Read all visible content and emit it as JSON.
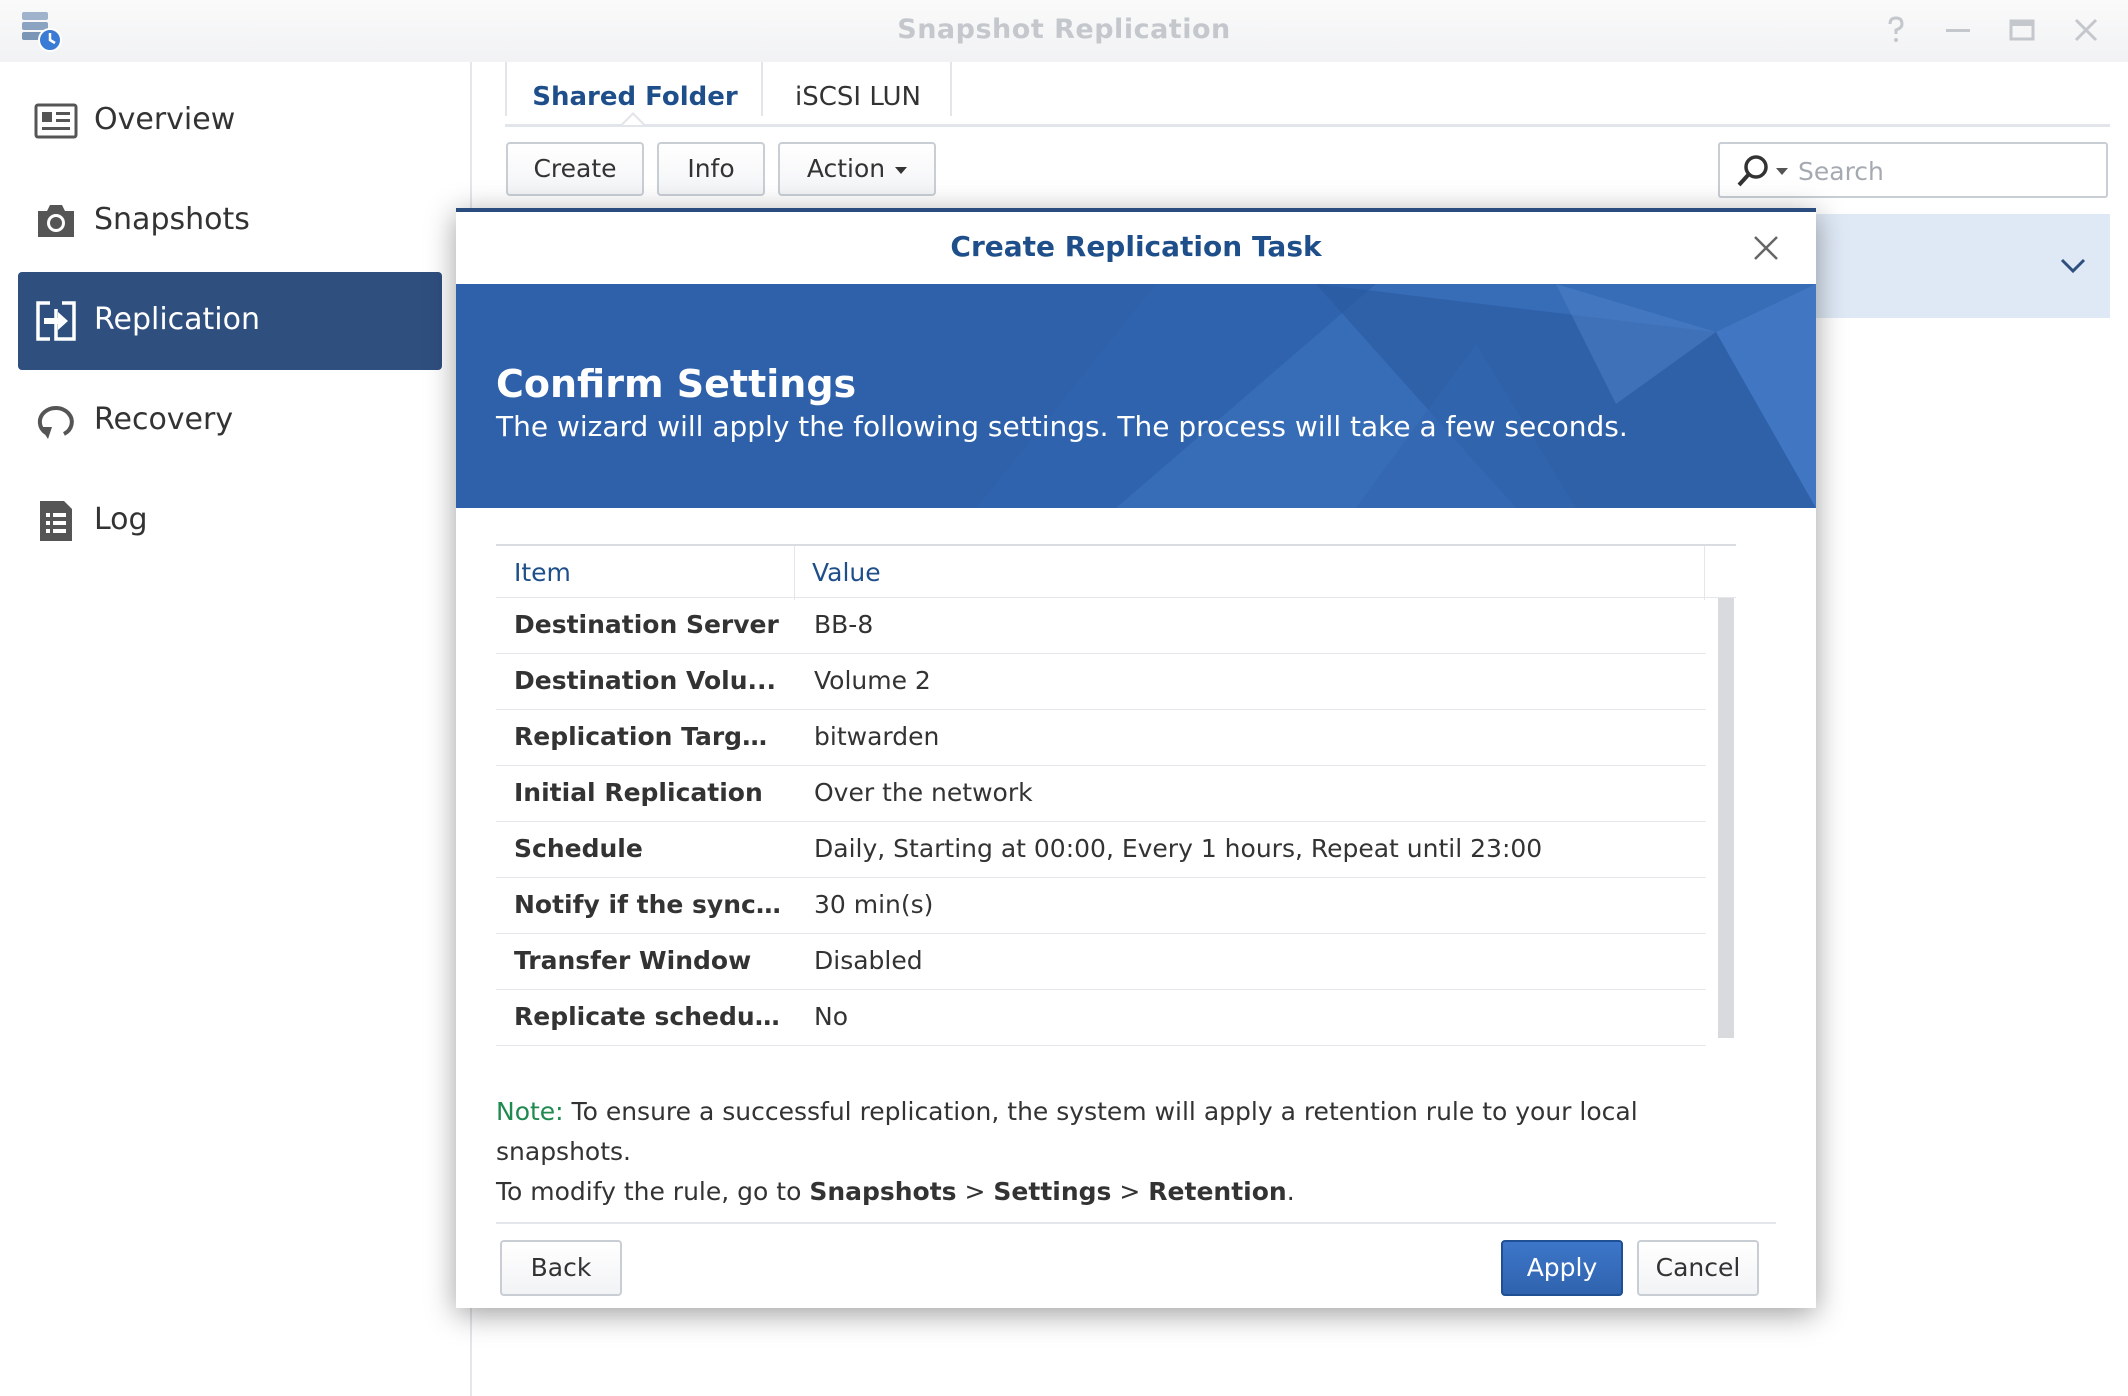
{
  "window": {
    "title": "Snapshot Replication",
    "controls": [
      "help-icon",
      "minimize-icon",
      "maximize-icon",
      "close-icon"
    ]
  },
  "sidebar": {
    "items": [
      {
        "label": "Overview",
        "icon": "overview-icon",
        "active": false
      },
      {
        "label": "Snapshots",
        "icon": "camera-icon",
        "active": false
      },
      {
        "label": "Replication",
        "icon": "replication-icon",
        "active": true
      },
      {
        "label": "Recovery",
        "icon": "recovery-icon",
        "active": false
      },
      {
        "label": "Log",
        "icon": "log-icon",
        "active": false
      }
    ]
  },
  "tabs": [
    {
      "label": "Shared Folder",
      "active": true
    },
    {
      "label": "iSCSI LUN",
      "active": false
    }
  ],
  "toolbar": {
    "create_label": "Create",
    "info_label": "Info",
    "action_label": "Action"
  },
  "search": {
    "placeholder": "Search",
    "value": ""
  },
  "dialog": {
    "title": "Create Replication Task",
    "banner_title": "Confirm Settings",
    "banner_subtitle": "The wizard will apply the following settings. The process will take a few seconds.",
    "table": {
      "headers": [
        "Item",
        "Value"
      ],
      "rows": [
        {
          "item": "Destination Server",
          "value": "BB-8"
        },
        {
          "item": "Destination Volu...",
          "value": "Volume 2"
        },
        {
          "item": "Replication Targe...",
          "value": "bitwarden"
        },
        {
          "item": "Initial Replication",
          "value": "Over the network"
        },
        {
          "item": "Schedule",
          "value": "Daily, Starting at 00:00, Every 1 hours, Repeat until 23:00"
        },
        {
          "item": "Notify if the sync ...",
          "value": "30 min(s)"
        },
        {
          "item": "Transfer Window",
          "value": "Disabled"
        },
        {
          "item": "Replicate schedul...",
          "value": "No"
        }
      ]
    },
    "note": {
      "label": "Note:",
      "text1": " To ensure a successful replication, the system will apply a retention rule to your local snapshots.",
      "text2": "To modify the rule, go to ",
      "link1": "Snapshots",
      "sep1": " > ",
      "link2": "Settings",
      "sep2": " > ",
      "link3": "Retention",
      "end": "."
    },
    "buttons": {
      "back": "Back",
      "apply": "Apply",
      "cancel": "Cancel"
    }
  },
  "colors": {
    "accent": "#2f63ad",
    "sidebar_active": "#2f4f7f",
    "title_blue": "#1f4f8a",
    "note_green": "#1f8a4f"
  }
}
